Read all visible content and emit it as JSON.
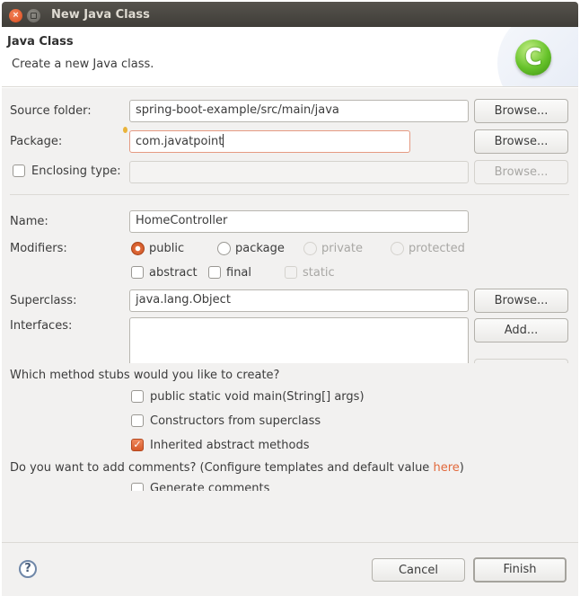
{
  "window": {
    "title": "New Java Class"
  },
  "header": {
    "title": "Java Class",
    "description": "Create a new Java class.",
    "icon": "java-class-c-icon"
  },
  "form": {
    "source_folder": {
      "label": "Source folder:",
      "value": "spring-boot-example/src/main/java",
      "browse": "Browse..."
    },
    "package": {
      "label": "Package:",
      "value": "com.javatpoint",
      "browse": "Browse..."
    },
    "enclosing_type": {
      "label": "Enclosing type:",
      "value": "",
      "browse": "Browse...",
      "checked": false
    },
    "name": {
      "label": "Name:",
      "value": "HomeController"
    },
    "modifiers": {
      "label": "Modifiers:",
      "visibility": [
        {
          "label": "public",
          "selected": true,
          "enabled": true
        },
        {
          "label": "package",
          "selected": false,
          "enabled": true
        },
        {
          "label": "private",
          "selected": false,
          "enabled": false
        },
        {
          "label": "protected",
          "selected": false,
          "enabled": false
        }
      ],
      "flags": [
        {
          "label": "abstract",
          "checked": false,
          "enabled": true
        },
        {
          "label": "final",
          "checked": false,
          "enabled": true
        },
        {
          "label": "static",
          "checked": false,
          "enabled": false
        }
      ]
    },
    "superclass": {
      "label": "Superclass:",
      "value": "java.lang.Object",
      "browse": "Browse..."
    },
    "interfaces": {
      "label": "Interfaces:",
      "add": "Add..."
    },
    "method_stubs": {
      "question": "Which method stubs would you like to create?",
      "options": [
        {
          "label": "public static void main(String[] args)",
          "checked": false
        },
        {
          "label": "Constructors from superclass",
          "checked": false
        },
        {
          "label": "Inherited abstract methods",
          "checked": true
        }
      ]
    },
    "comments": {
      "question": "Do you want to add comments? (Configure templates and default value ",
      "link": "here",
      "question_end": ")",
      "option": {
        "label": "Generate comments",
        "checked": false
      }
    }
  },
  "footer": {
    "help": "?",
    "cancel": "Cancel",
    "finish": "Finish"
  },
  "colors": {
    "accent": "#e2693c",
    "titlebar": "#4a4843",
    "background": "#f2f1f0"
  }
}
